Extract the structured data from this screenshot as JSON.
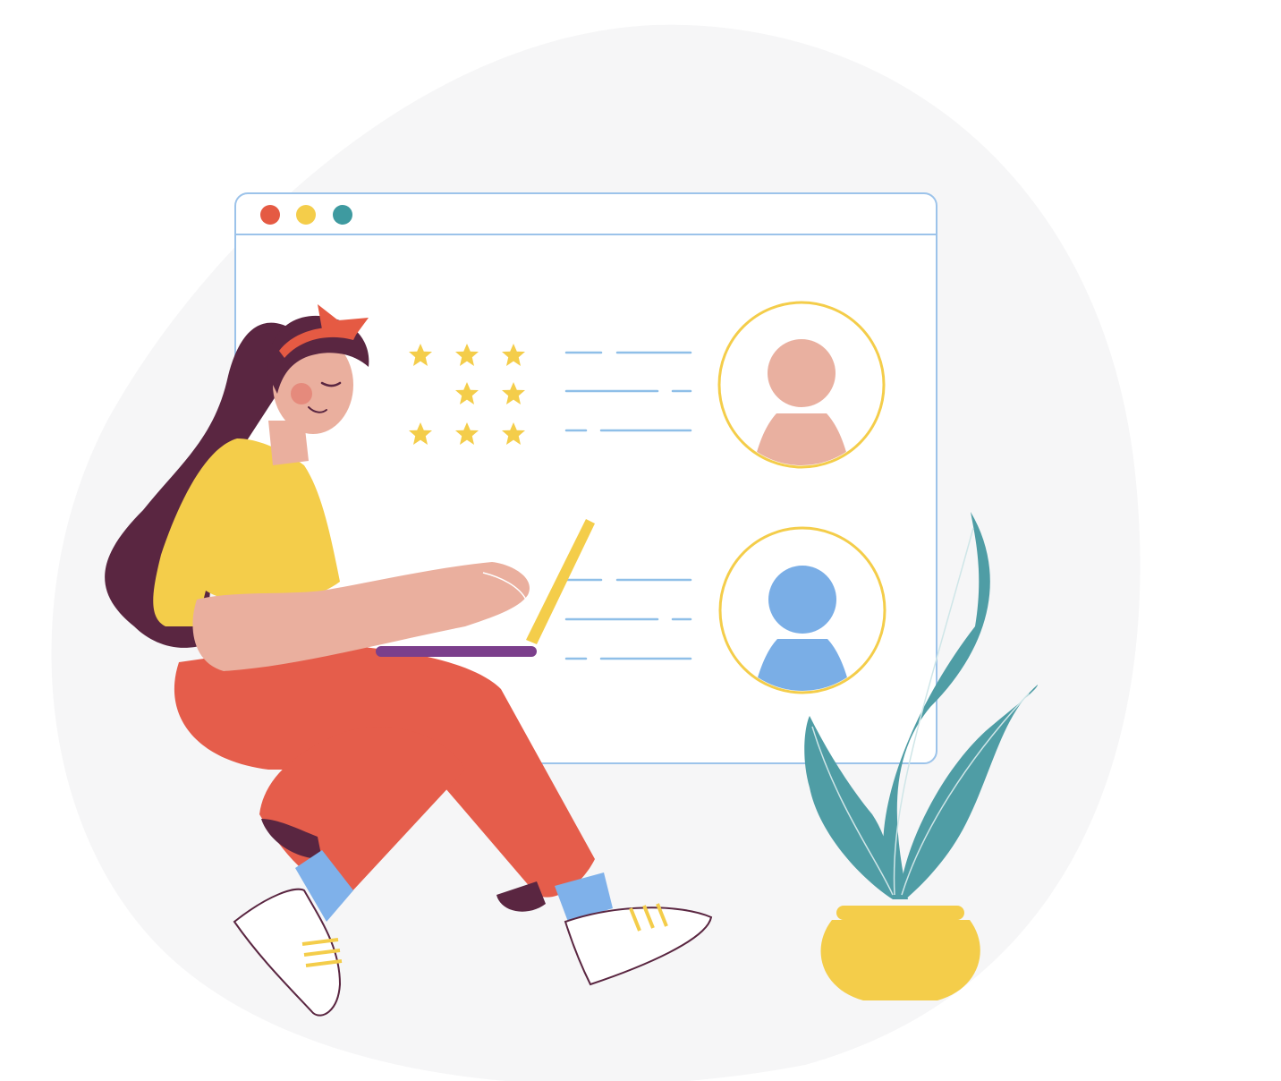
{
  "colors": {
    "background": "#ffffff",
    "blob": "#f6f6f7",
    "window_border": "#9cc3ea",
    "window_bg": "#ffffff",
    "dot_red": "#e55a43",
    "dot_yellow": "#f4cd4a",
    "dot_teal": "#3e9aa0",
    "star": "#f4cd4a",
    "line": "#8fbfe8",
    "avatar_ring": "#f4cd4a",
    "avatar_pink": "#e9b0a0",
    "avatar_blue": "#7aaee6",
    "hair": "#5a2641",
    "skin": "#eaaf9e",
    "shirt": "#f4cd4a",
    "pants": "#e55d4b",
    "laptop": "#f4cd4a",
    "laptop_base": "#7b3f8c",
    "sock": "#7fb1ea",
    "shoe": "#ffffff",
    "leaf": "#4f9da5",
    "pot": "#f4cd4a",
    "headband": "#e55a43"
  },
  "window": {
    "title_dots": [
      "close",
      "minimize",
      "maximize"
    ],
    "reviews": [
      {
        "stars": 3,
        "avatar": "pink"
      },
      {
        "stars": 0,
        "avatar": "blue"
      }
    ]
  },
  "icons": [
    "star-icon",
    "user-avatar-icon"
  ]
}
